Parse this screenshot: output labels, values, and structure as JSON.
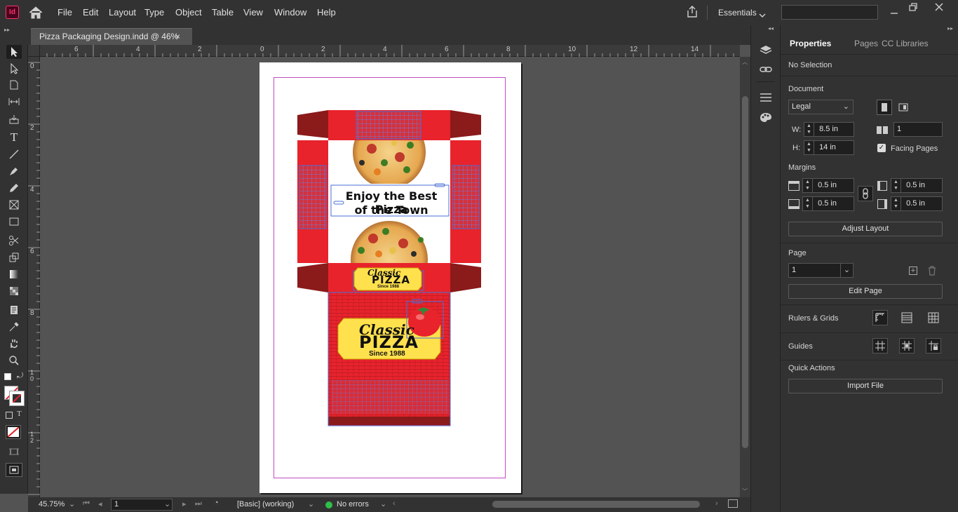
{
  "app": {
    "logo": "Id"
  },
  "menu": [
    "File",
    "Edit",
    "Layout",
    "Type",
    "Object",
    "Table",
    "View",
    "Window",
    "Help"
  ],
  "workspace": {
    "label": "Essentials",
    "search_placeholder": ""
  },
  "document_tab": {
    "title": "Pizza Packaging Design.indd @ 46%",
    "close": "×"
  },
  "ruler": {
    "h_ticks": [
      "6",
      "4",
      "2",
      "0",
      "2",
      "4",
      "6",
      "8",
      "10",
      "12",
      "14"
    ],
    "v_ticks": [
      "0",
      "2",
      "4",
      "6",
      "8",
      "1\n0",
      "1\n2"
    ]
  },
  "artwork": {
    "headline_line1": "Enjoy the Best Pizza",
    "headline_line2": "of the Town",
    "logo_small_script": "Classic",
    "logo_small_main": "PIZZA",
    "logo_small_since": "Since 1988",
    "logo_big_script": "Classic",
    "logo_big_main": "PIZZA",
    "logo_big_since": "Since 1988"
  },
  "status": {
    "zoom": "45.75%",
    "page": "1",
    "style": "[Basic] (working)",
    "preflight": "No errors"
  },
  "panel": {
    "tabs": [
      "Properties",
      "Pages",
      "CC Libraries"
    ],
    "selection": "No Selection",
    "document_label": "Document",
    "preset": "Legal",
    "w_label": "W:",
    "w_value": "8.5 in",
    "h_label": "H:",
    "h_value": "14 in",
    "pages_value": "1",
    "facing_pages": "Facing Pages",
    "margins_label": "Margins",
    "margin_top": "0.5 in",
    "margin_bottom": "0.5 in",
    "margin_left": "0.5 in",
    "margin_right": "0.5 in",
    "adjust_layout": "Adjust Layout",
    "page_label": "Page",
    "page_value": "1",
    "edit_page": "Edit Page",
    "rulers_grids": "Rulers & Grids",
    "guides": "Guides",
    "quick_actions": "Quick Actions",
    "import_file": "Import File"
  },
  "colors": {
    "accent": "#ff3366",
    "box_red": "#e8232c",
    "box_dark": "#8b1a1a",
    "logo_yellow": "#ffe14d",
    "frame_blue": "#4a6fd6"
  }
}
